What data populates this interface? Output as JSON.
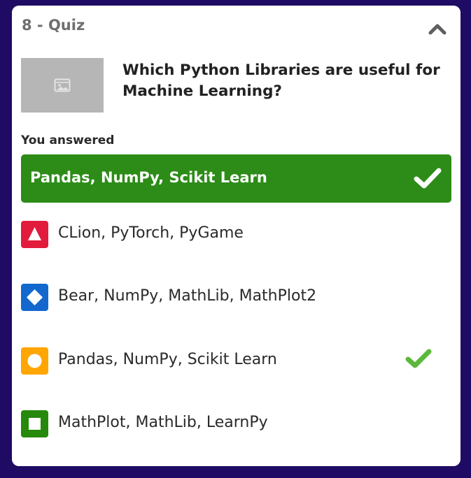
{
  "quiz": {
    "title": "8 - Quiz",
    "question": "Which Python Libraries are useful for Machine Learning?",
    "answered_label": "You answered",
    "selected_answer": "Pandas, NumPy, Scikit Learn",
    "colors": {
      "background": "#1f0b63",
      "correct_green": "#2c8c17",
      "check_light": "#5cb83c"
    },
    "options": [
      {
        "text": "CLion, PyTorch, PyGame",
        "shape": "triangle",
        "color": "#e21b3c"
      },
      {
        "text": "Bear, NumPy, MathLib, MathPlot2",
        "shape": "diamond",
        "color": "#1368ce"
      },
      {
        "text": "Pandas, NumPy, Scikit Learn",
        "shape": "circle",
        "color": "#ffa602",
        "correct": true
      },
      {
        "text": "MathPlot, MathLib, LearnPy",
        "shape": "square",
        "color": "#26890c"
      }
    ],
    "icons": {
      "collapse": "chevron-up-icon",
      "thumbnail": "image-placeholder-icon",
      "check": "checkmark-icon"
    }
  }
}
